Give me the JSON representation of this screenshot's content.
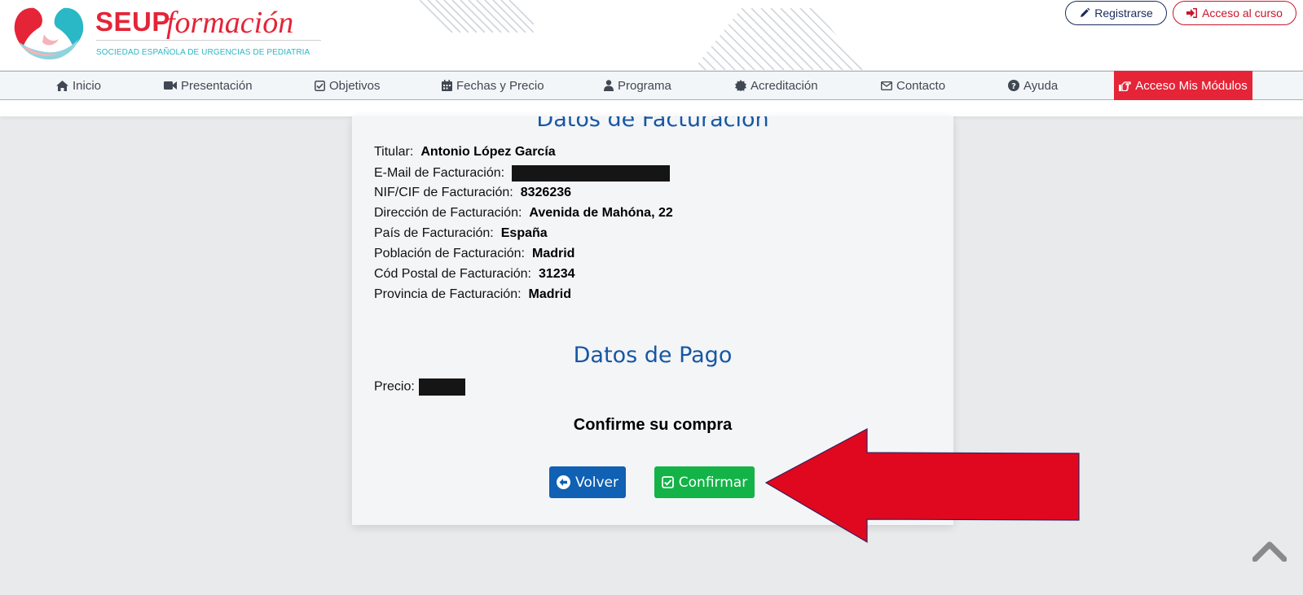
{
  "logo": {
    "brand": "SEUP",
    "brand_script": "formación",
    "subtitle": "SOCIEDAD ESPAÑOLA DE URGENCIAS DE PEDIATRIA"
  },
  "top_buttons": {
    "register_label": "Registrarse",
    "course_access_label": "Acceso al curso"
  },
  "nav": {
    "items": [
      {
        "label": "Inicio",
        "icon": "home-icon"
      },
      {
        "label": "Presentación",
        "icon": "video-camera-icon"
      },
      {
        "label": "Objetivos",
        "icon": "check-square-icon"
      },
      {
        "label": "Fechas y Precio",
        "icon": "calendar-icon"
      },
      {
        "label": "Programa",
        "icon": "user-icon"
      },
      {
        "label": "Acreditación",
        "icon": "certificate-icon"
      },
      {
        "label": "Contacto",
        "icon": "envelope-icon"
      },
      {
        "label": "Ayuda",
        "icon": "question-circle-icon"
      },
      {
        "label": "Acceso Mis Módulos",
        "icon": "hand-pointer-icon"
      }
    ]
  },
  "billing": {
    "title": "Datos de Facturación",
    "rows": [
      {
        "label": "Titular:",
        "value": "Antonio López García"
      },
      {
        "label": "E-Mail de Facturación:",
        "value": ""
      },
      {
        "label": "NIF/CIF de Facturación:",
        "value": "8326236"
      },
      {
        "label": "Dirección de Facturación:",
        "value": "Avenida de Mahóna, 22"
      },
      {
        "label": "País de Facturación:",
        "value": "España"
      },
      {
        "label": "Población de Facturación:",
        "value": "Madrid"
      },
      {
        "label": "Cód Postal de Facturación:",
        "value": "31234"
      },
      {
        "label": "Provincia de Facturación:",
        "value": "Madrid"
      }
    ]
  },
  "payment": {
    "title": "Datos de Pago",
    "price_label": "Precio:"
  },
  "confirm": {
    "prompt": "Confirme su compra",
    "back_label": "Volver",
    "confirm_label": "Confirmar"
  },
  "colors": {
    "brand_red": "#e52437",
    "heading_blue": "#1657a4",
    "back_blue": "#1060b4",
    "confirm_green": "#13b347",
    "arrow_red": "#e0081e"
  }
}
